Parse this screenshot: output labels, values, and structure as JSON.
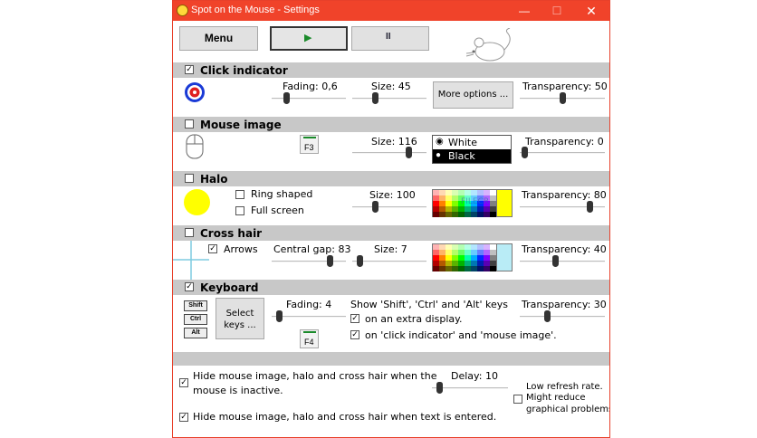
{
  "window": {
    "title": "Spot on the Mouse - Settings",
    "controls": {
      "minimize": "—",
      "maximize": "☐",
      "close": "✕"
    }
  },
  "toolbar": {
    "menu_label": "Menu",
    "play_glyph": "▶",
    "pause_glyph": "II"
  },
  "click_indicator": {
    "label": "Click indicator",
    "checked": true,
    "fading_label": "Fading: 0,6",
    "size_label": "Size: 45",
    "more_options_label": "More options ...",
    "transparency_label": "Transparency: 50",
    "fading_level": 0.2,
    "size_level": 0.3,
    "transparency_level": 0.5
  },
  "mouse_image": {
    "label": "Mouse image",
    "checked": false,
    "hotkey_label": "F3",
    "size_label": "Size: 116",
    "colors": [
      "White",
      "Black"
    ],
    "selected_color": "White",
    "transparency_label": "Transparency: 0",
    "size_level": 0.75,
    "transparency_level": 0.05
  },
  "halo": {
    "label": "Halo",
    "checked": false,
    "ring_shaped_label": "Ring shaped",
    "full_screen_label": "Full screen",
    "size_label": "Size: 100",
    "transparency_label": "Transparency: 80",
    "watermark": "FILECR",
    "size_level": 0.3,
    "transparency_level": 0.82,
    "color": "#ffff00"
  },
  "cross_hair": {
    "label": "Cross hair",
    "checked": false,
    "arrows_label": "Arrows",
    "arrows_checked": true,
    "central_gap_label": "Central gap: 83",
    "size_label": "Size: 7",
    "transparency_label": "Transparency: 40",
    "central_gap_level": 0.78,
    "size_level": 0.1,
    "transparency_level": 0.42,
    "color": "#b9ecf6"
  },
  "keyboard": {
    "label": "Keyboard",
    "checked": true,
    "keys": [
      "Shift",
      "Ctrl",
      "Alt"
    ],
    "select_keys_label": "Select keys ...",
    "fading_label": "Fading: 4",
    "show_keys_label": "Show 'Shift', 'Ctrl' and 'Alt' keys",
    "extra_display_label": "on an extra display.",
    "extra_display_checked": true,
    "on_indicator_label": "on 'click indicator' and 'mouse image'.",
    "on_indicator_checked": true,
    "hotkey_label": "F4",
    "transparency_label": "Transparency: 30",
    "fading_level": 0.1,
    "transparency_level": 0.32
  },
  "footer": {
    "hide_inactive_label": "Hide mouse image, halo and cross hair when the",
    "hide_inactive_label2": "mouse is inactive.",
    "hide_inactive_checked": true,
    "hide_text_label": "Hide mouse image, halo and cross hair when text is entered.",
    "hide_text_checked": true,
    "delay_label": "Delay: 10",
    "delay_level": 0.1,
    "low_refresh_label": "Low refresh rate.",
    "might_reduce_label": "Might reduce",
    "graphical_label": "graphical problems.",
    "low_refresh_checked": false
  },
  "colors": {
    "title_bar": "#f0432a",
    "section_header": "#c8c8c8",
    "accent_green": "#1a8a2a"
  }
}
